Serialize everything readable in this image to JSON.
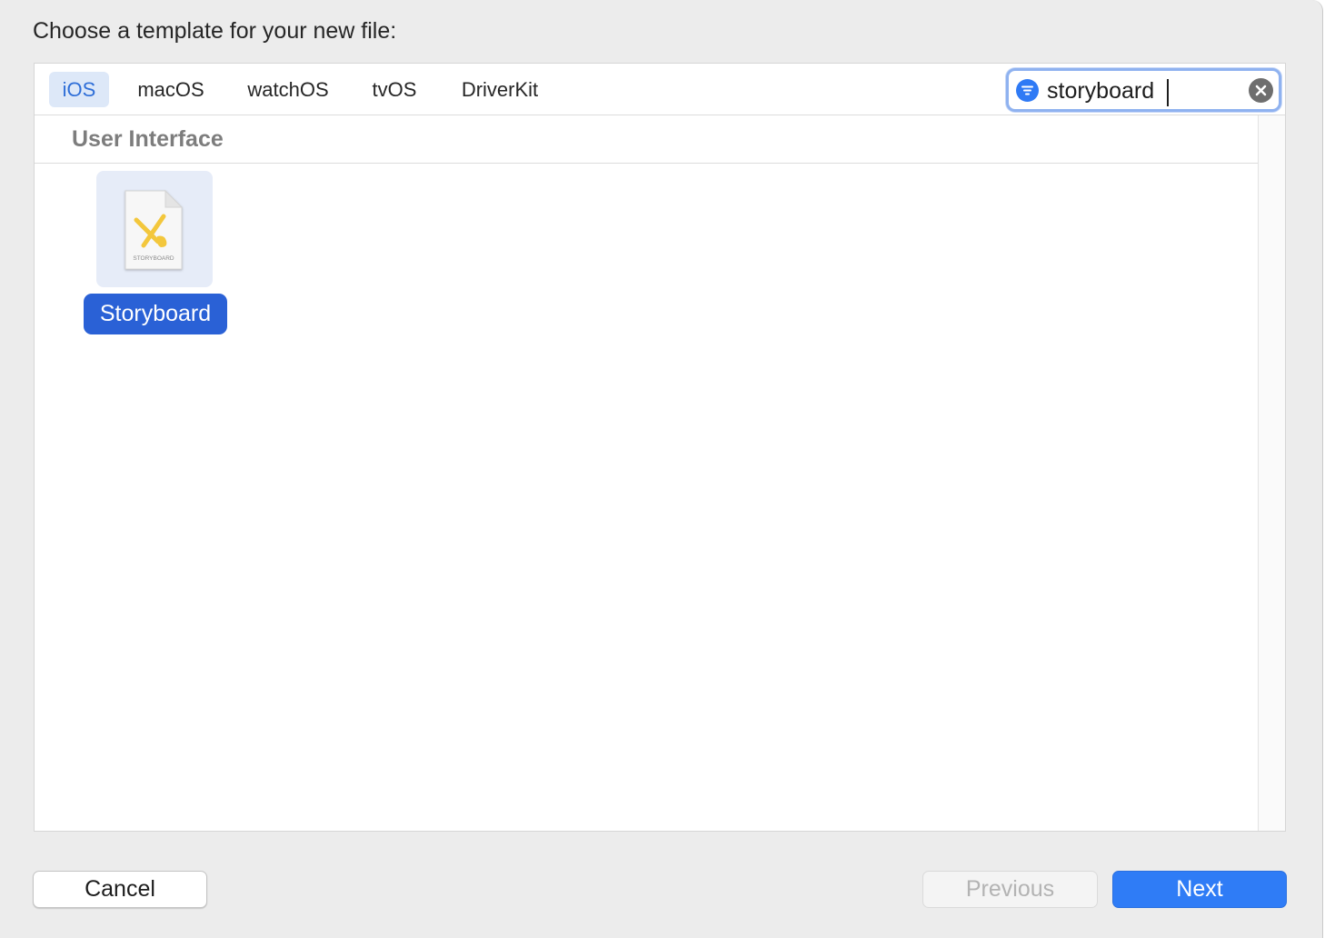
{
  "dialog": {
    "title": "Choose a template for your new file:"
  },
  "platform_tabs": [
    {
      "label": "iOS",
      "selected": true
    },
    {
      "label": "macOS",
      "selected": false
    },
    {
      "label": "watchOS",
      "selected": false
    },
    {
      "label": "tvOS",
      "selected": false
    },
    {
      "label": "DriverKit",
      "selected": false
    }
  ],
  "search": {
    "value": "storyboard",
    "filter_icon": "filter-icon",
    "clear_icon": "clear-icon"
  },
  "section": {
    "title": "User Interface"
  },
  "templates": [
    {
      "label": "Storyboard",
      "icon": "storyboard-file-icon",
      "icon_caption": "STORYBOARD",
      "selected": true
    }
  ],
  "buttons": {
    "cancel": "Cancel",
    "previous": "Previous",
    "next": "Next"
  },
  "colors": {
    "accent": "#2f7cf6",
    "selection": "#2a61d6",
    "tab_selected_bg": "#dde8f8",
    "storyboard_icon": "#f3c73c"
  }
}
